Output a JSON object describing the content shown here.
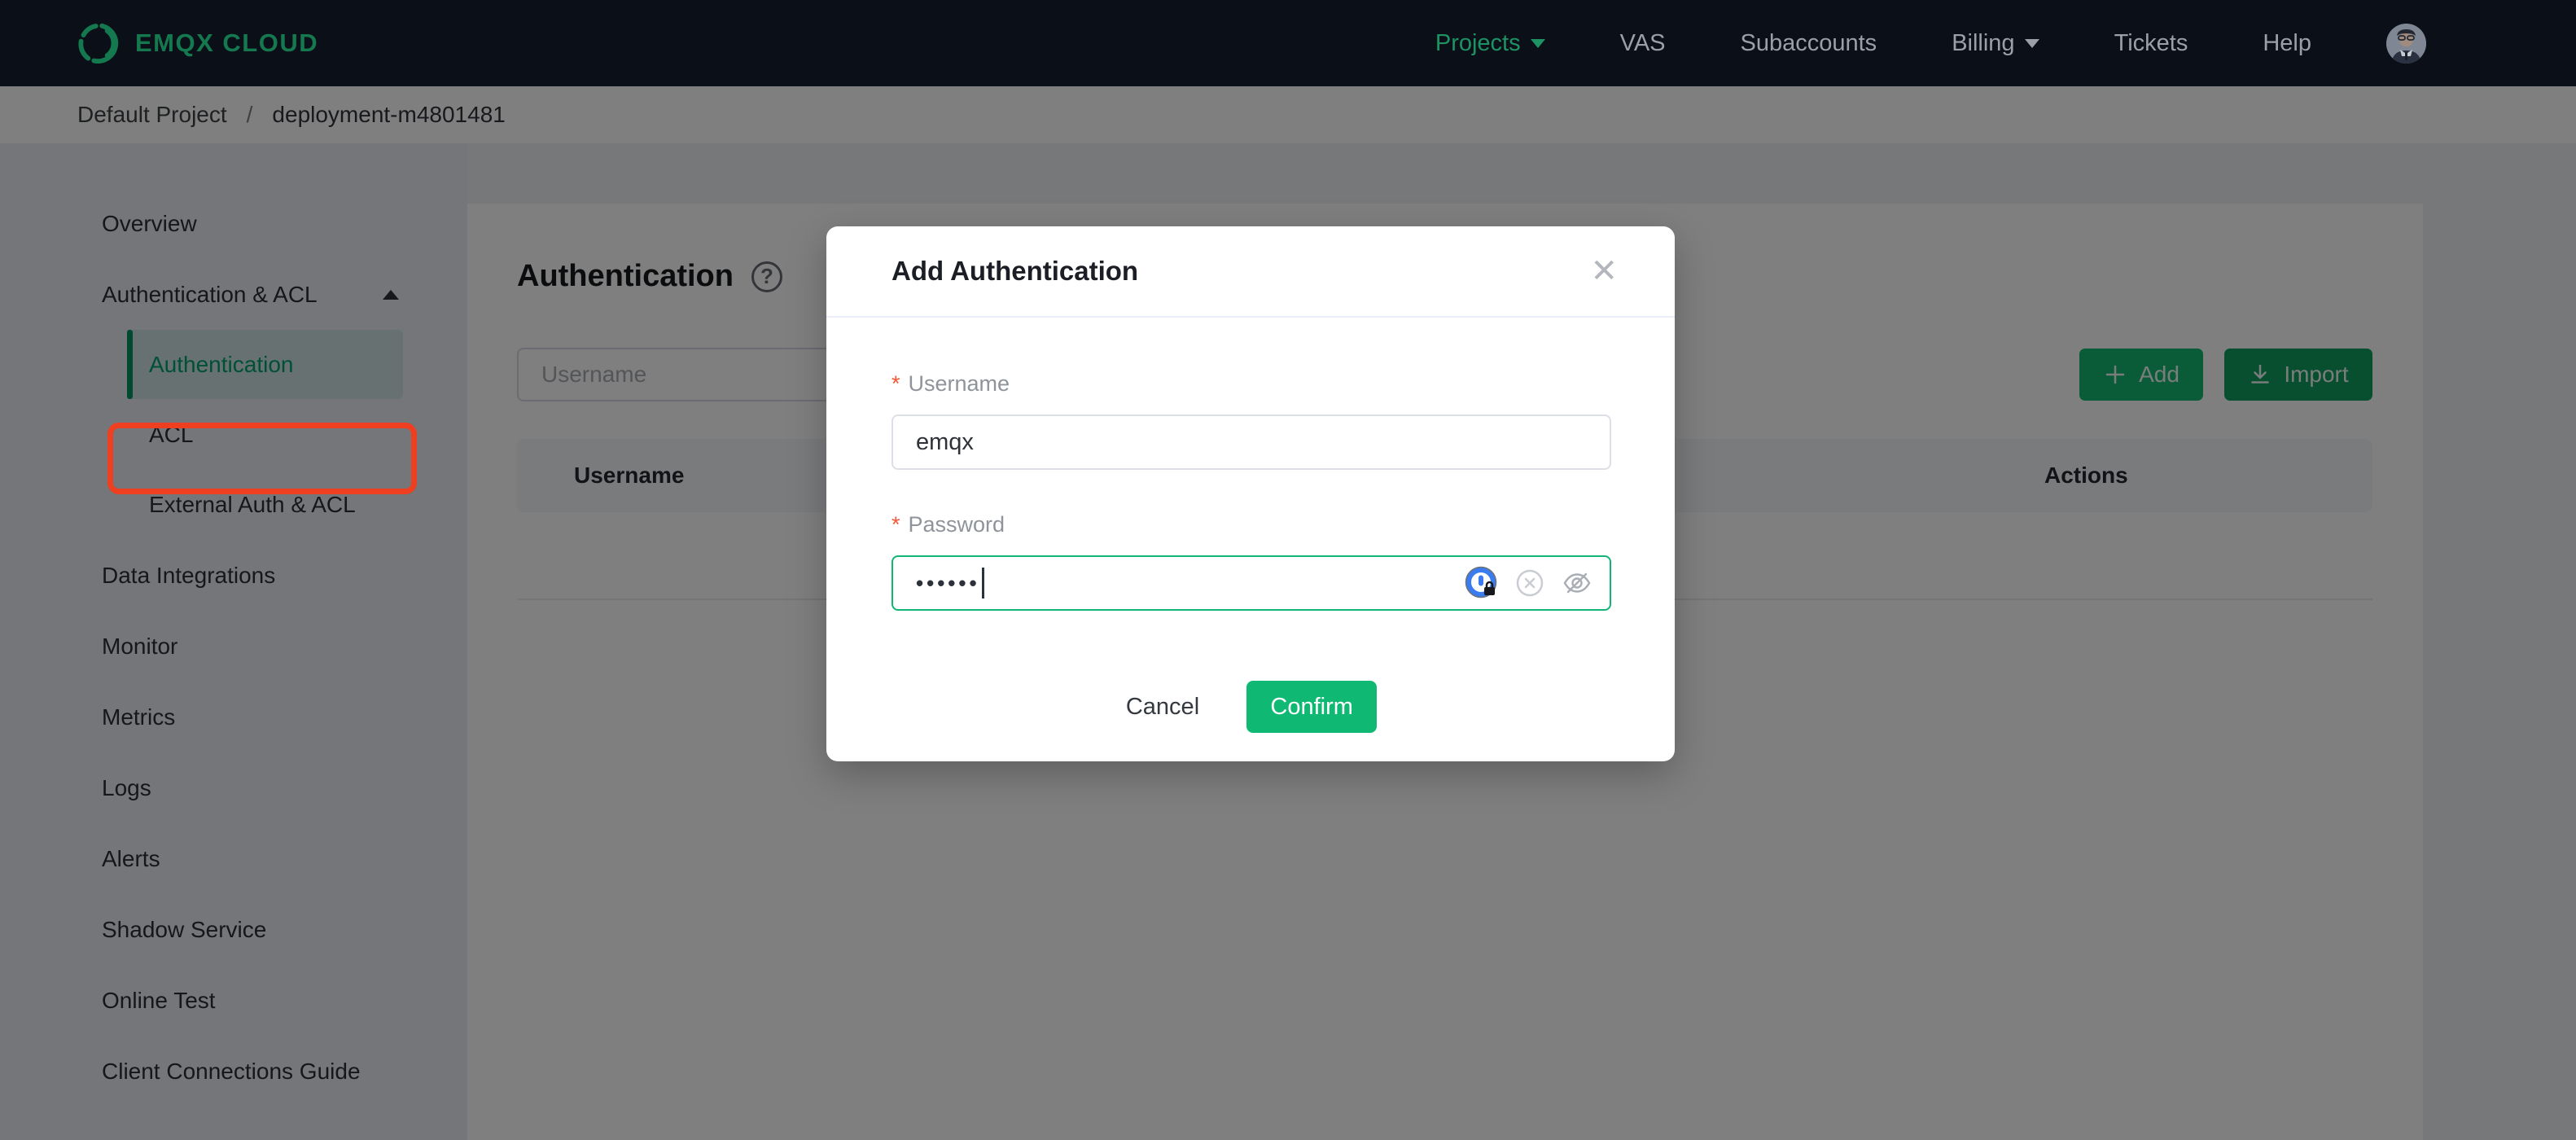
{
  "navbar": {
    "logo_text": "EMQX CLOUD",
    "items": [
      {
        "label": "Projects",
        "active": true,
        "has_caret": true
      },
      {
        "label": "VAS"
      },
      {
        "label": "Subaccounts"
      },
      {
        "label": "Billing",
        "has_caret": true
      },
      {
        "label": "Tickets"
      },
      {
        "label": "Help"
      }
    ]
  },
  "breadcrumb": {
    "project": "Default Project",
    "separator": "/",
    "deployment": "deployment-m4801481"
  },
  "sidebar": {
    "items": [
      {
        "label": "Overview"
      },
      {
        "label": "Authentication & ACL",
        "expanded": true
      },
      {
        "label": "Authentication",
        "active": true,
        "annotated": true
      },
      {
        "label": "ACL"
      },
      {
        "label": "External Auth & ACL"
      },
      {
        "label": "Data Integrations"
      },
      {
        "label": "Monitor"
      },
      {
        "label": "Metrics"
      },
      {
        "label": "Logs"
      },
      {
        "label": "Alerts"
      },
      {
        "label": "Shadow Service"
      },
      {
        "label": "Online Test"
      },
      {
        "label": "Client Connections Guide"
      }
    ]
  },
  "main": {
    "title": "Authentication",
    "search_placeholder": "Username",
    "add_label": "Add",
    "import_label": "Import",
    "table": {
      "columns": [
        "Username",
        "Actions"
      ],
      "rows": []
    }
  },
  "modal": {
    "title": "Add Authentication",
    "username_label": "Username",
    "username_value": "emqx",
    "password_label": "Password",
    "password_masked_value": "••••••",
    "required_marker": "*",
    "cancel_label": "Cancel",
    "confirm_label": "Confirm"
  },
  "colors": {
    "brand_green": "#10b973",
    "nav_active_green": "#1f9263",
    "sidebar_active_green": "#00a06a",
    "add_button_green": "#14b870",
    "import_button_green": "#109e60",
    "required_red": "#f25633",
    "annotation_red": "#ee3f20",
    "navbar_bg": "#0b0f18"
  }
}
